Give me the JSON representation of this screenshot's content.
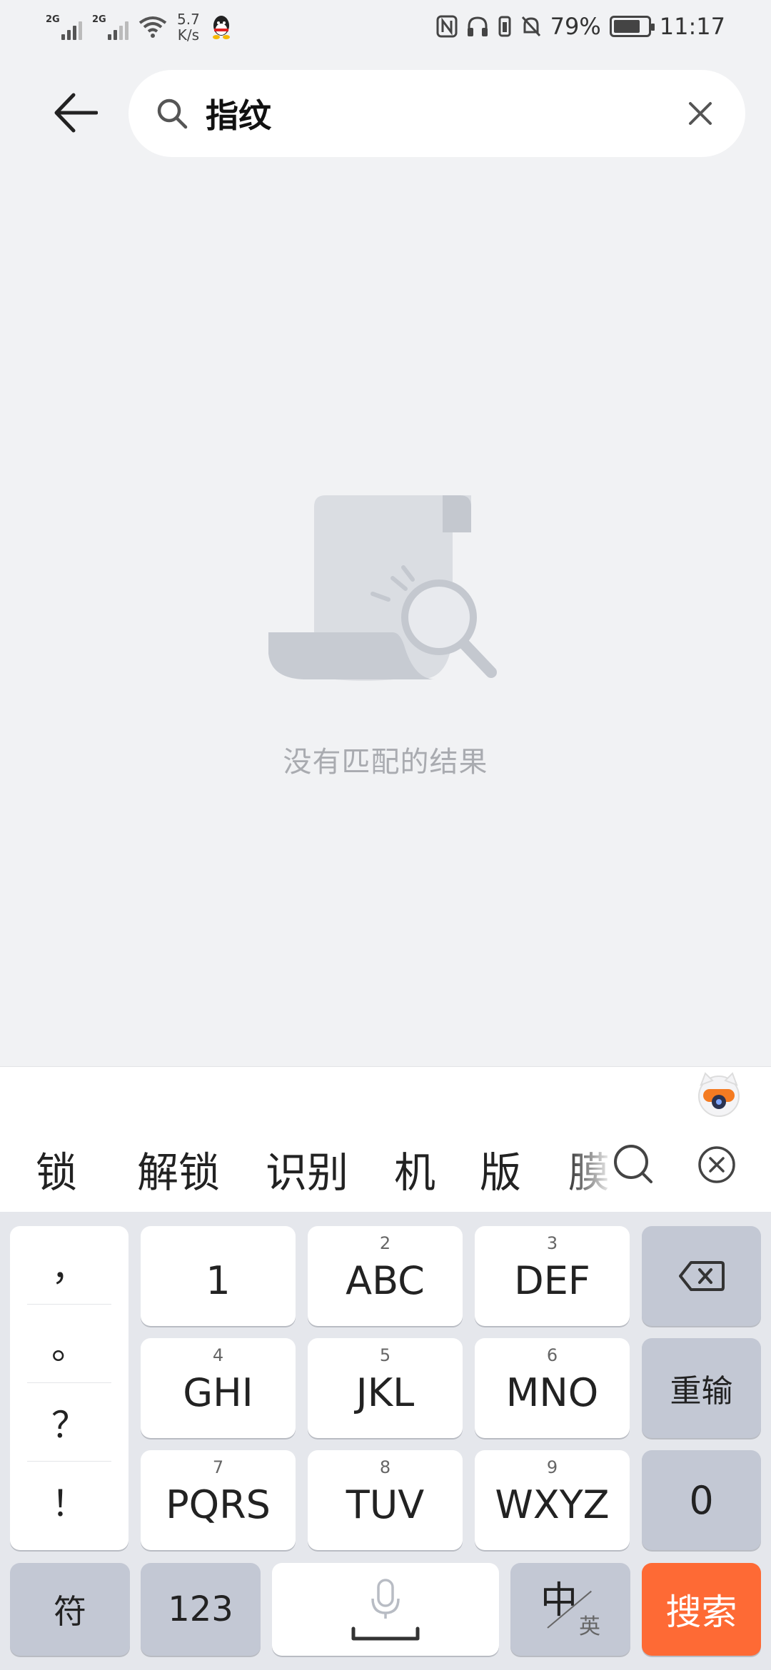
{
  "status_bar": {
    "signal1_label": "2G",
    "signal2_label": "2G",
    "net_speed_value": "5.7",
    "net_speed_unit": "K/s",
    "battery_percent": "79%",
    "battery_level": 0.79,
    "time": "11:17",
    "icons": [
      "wifi-icon",
      "qq-icon",
      "nfc-icon",
      "headphones-icon",
      "vibrate-icon",
      "mute-bell-icon",
      "battery-icon"
    ]
  },
  "search": {
    "query": "指纹",
    "back_icon": "arrow-left-icon",
    "search_icon": "search-icon",
    "clear_icon": "close-icon"
  },
  "empty_state": {
    "message": "没有匹配的结果",
    "icon": "document-search-icon"
  },
  "keyboard": {
    "candidates": [
      "锁",
      "解锁",
      "识别",
      "机",
      "版",
      "膜"
    ],
    "punctuation": [
      "，",
      "。",
      "？",
      "！"
    ],
    "keys": {
      "k1": {
        "main": "1",
        "sub": ""
      },
      "k2": {
        "main": "ABC",
        "sub": "2"
      },
      "k3": {
        "main": "DEF",
        "sub": "3"
      },
      "k4": {
        "main": "GHI",
        "sub": "4"
      },
      "k5": {
        "main": "JKL",
        "sub": "5"
      },
      "k6": {
        "main": "MNO",
        "sub": "6"
      },
      "k7": {
        "main": "PQRS",
        "sub": "7"
      },
      "k8": {
        "main": "TUV",
        "sub": "8"
      },
      "k9": {
        "main": "WXYZ",
        "sub": "9"
      },
      "k0": {
        "main": "0"
      }
    },
    "reenter_label": "重输",
    "symbols_label": "符",
    "numeric_label": "123",
    "lang_zh": "中",
    "lang_en": "英",
    "search_label": "搜索",
    "accent_color": "#fe6a35"
  }
}
